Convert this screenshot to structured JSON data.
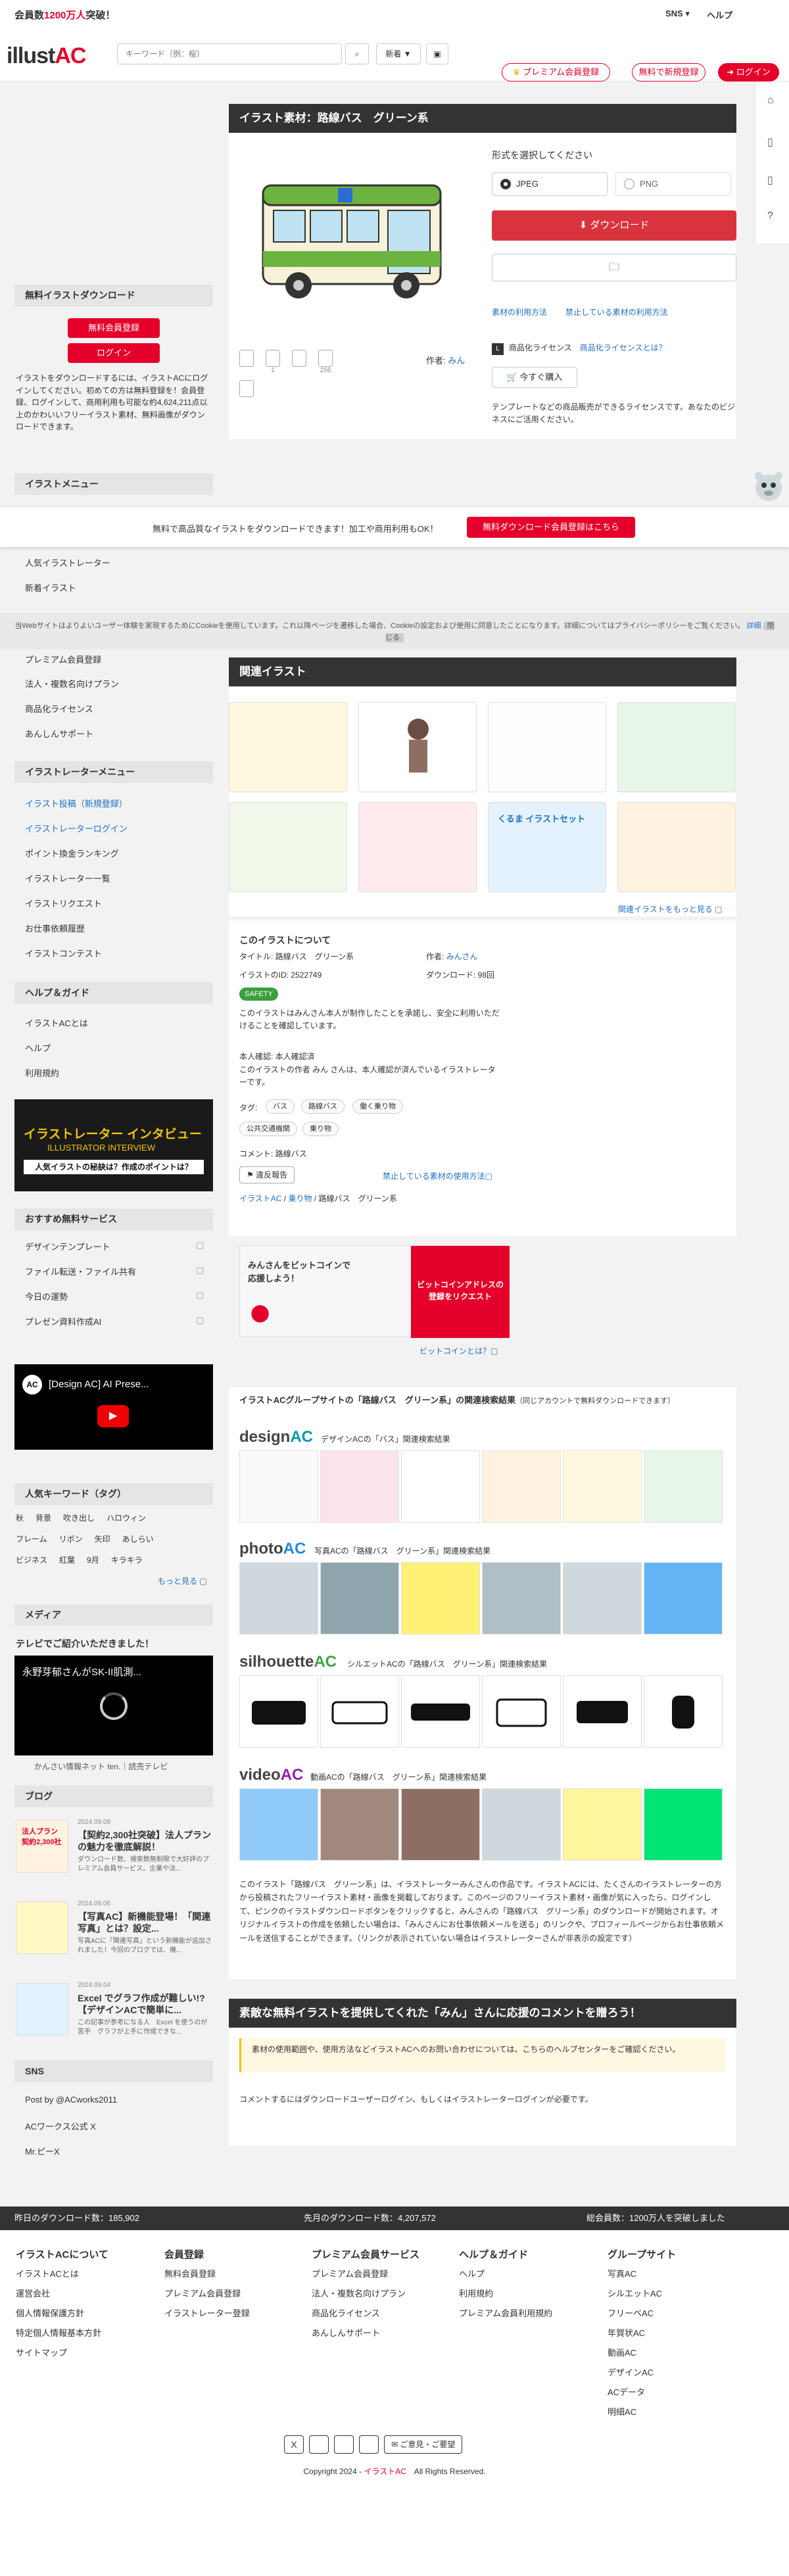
{
  "topbar": {
    "notice_prefix": "会員数",
    "notice_highlight": "1200万人",
    "notice_suffix": "突破！",
    "sns": "SNS ▾",
    "help": "ヘルプ"
  },
  "header": {
    "logo_text": "illust",
    "logo_ac": "AC",
    "search_placeholder": "キーワード（例：桜）",
    "sort_label": "新着 ▼",
    "premium_label": "プレミアム会員登録",
    "free_label": "無料で新規登録",
    "login_label": "ログイン"
  },
  "left": {
    "download_title": "無料イラストダウンロード",
    "free_register": "無料会員登録",
    "login": "ログイン",
    "download_text": "イラストをダウンロードするには、イラストACにログインしてください。初めての方は無料登録を！会員登録、ログインして、商用利用も可能な約4,624,211点以上のかわいいフリーイラスト素材、無料画像がダウンロードできます。",
    "menu_title": "イラストメニュー",
    "menu_items": [
      "人気イラストレーター",
      "新着イラスト",
      "プレミアム会員登録",
      "法人・複数名向けプラン",
      "商品化ライセンス",
      "あんしんサポート"
    ],
    "creator_title": "イラストレーターメニュー",
    "creator_items": [
      "イラスト投稿（新規登録）",
      "イラストレーターログイン",
      "ポイント換金ランキング",
      "イラストレーター一覧",
      "イラストリクエスト",
      "お仕事依頼履歴",
      "イラストコンテスト"
    ],
    "help_title": "ヘルプ＆ガイド",
    "help_items": [
      "イラストACとは",
      "ヘルプ",
      "利用規約"
    ],
    "interview": {
      "line1": "イラストレーター インタビュー",
      "line2": "ILLUSTRATOR INTERVIEW",
      "line3": "人気イラストの秘訣は？作成のポイントは？"
    },
    "services_title": "おすすめ無料サービス",
    "services": [
      "デザインテンプレート",
      "ファイル転送・ファイル共有",
      "今日の運勢",
      "プレゼン資料作成AI"
    ],
    "video1_title": "[Design AC] AI Prese...",
    "tags_title": "人気キーワード（タグ）",
    "tags_rows": [
      [
        "秋",
        "背景",
        "吹き出し",
        "ハロウィン"
      ],
      [
        "フレーム",
        "リボン",
        "矢印",
        "あしらい"
      ],
      [
        "ビジネス",
        "紅葉",
        "9月",
        "キラキラ"
      ]
    ],
    "tags_more": "もっと見る ▢",
    "media_title": "メディア",
    "media_text": "テレビでご紹介いただきました！",
    "video2_title": "永野芽郁さんがSK-II肌測...",
    "video2_caption": "かんさい情報ネット ten.｜読売テレビ",
    "blog_title": "ブログ",
    "blogs": [
      {
        "date": "2024.09.09",
        "title": "【契約2,300社突破】法人プランの魅力を徹底解説！",
        "excerpt": "ダウンロード数、検索数無制限で大好評のプレミアム会員サービス。企業や法..."
      },
      {
        "date": "2024.09.06",
        "title": "【写真AC】新機能登場！「関連写真」とは？設定...",
        "excerpt": "写真ACに「関連写真」という新機能が追加されました！今回のブログでは、機..."
      },
      {
        "date": "2024.09.04",
        "title": "Excel でグラフ作成が難しい!?【デザインACで簡単に...",
        "excerpt": "この記事が参考になる人　Excel を使うのが苦手　グラフが上手に作成できな..."
      }
    ],
    "blog_thumb_text": "法人プラン 契約2,300社",
    "sns_title": "SNS",
    "sns_items": [
      "Post by @ACworks2011",
      "ACワークス公式 X",
      "Mr.ピーX"
    ]
  },
  "detail": {
    "title": "イラスト素材：路線バス　グリーン系",
    "format_label": "形式を選択してください",
    "jpeg": "JPEG",
    "png": "PNG",
    "download_btn": "ダウンロード",
    "terms": "素材の利用方法",
    "prohibited": "禁止している素材の利用方法",
    "license_prefix": "商品化ライセンス",
    "license_link": "商品化ライセンスとは？",
    "buy_now": "今すぐ購入",
    "template_note": "テンプレートなどの商品販売ができるライセンスです。あなたのビジネスにご活用ください。",
    "author_label": "作者:",
    "author": "みん",
    "counts": [
      "",
      "1",
      "",
      "256"
    ]
  },
  "banner": {
    "text": "無料で高品質なイラストをダウンロードできます！加工や商用利用もOK！",
    "button": "無料ダウンロード会員登録はこちら"
  },
  "cookie": {
    "text": "当Webサイトはよりよいユーザー体験を実現するためにCookieを使用しています。これ以降ページを遷移した場合、Cookieの設定および使用に同意したことになります。詳細についてはプライバシーポリシーをご覧ください。",
    "details": "詳細",
    "close": "閉じる"
  },
  "related": {
    "title": "関連イラスト",
    "more": "関連イラストをもっと見る ▢",
    "thumb7_text": "くるま イラストセット"
  },
  "about": {
    "heading": "このイラストについて",
    "title_label": "タイトル: 路線バス　グリーン系",
    "author_label": "作者: ",
    "author": "みんさん",
    "id_label": "イラストのID: 2522749",
    "downloads_label": "ダウンロード: 98回",
    "safety": "SAFETY",
    "safety_text": "このイラストはみんさん本人が制作したことを承諾し、安全に利用いただけることを確認しています。",
    "verify_label": "本人確認: 本人確認済",
    "verify_text": "このイラストの作者 みん さんは、本人確認が済んでいるイラストレーターです。",
    "tags_label": "タグ:",
    "tags": [
      "バス",
      "路線バス",
      "働く乗り物",
      "公共交通機関",
      "乗り物"
    ],
    "comment_label": "コメント: 路線バス",
    "report": "違反報告",
    "prohibited": "禁止している素材の使用方法▢",
    "breadcrumb": [
      "イラストAC",
      "乗り物",
      "路線バス　グリーン系"
    ]
  },
  "bitcoin": {
    "text": "みんさんをビットコインで応援しよう！",
    "button_line1": "ビットコインアドレスの",
    "button_line2": "登録をリクエスト",
    "link": "ビットコインとは？▢"
  },
  "group": {
    "heading": "イラストACグループサイトの「路線バス　グリーン系」の関連検索結果",
    "heading_note": "（同じアカウントで無料ダウンロードできます）",
    "sites": [
      {
        "logo": "design",
        "ac": "AC",
        "label": "デザインACの「バス」関連検索結果"
      },
      {
        "logo": "photo",
        "ac": "AC",
        "label": "写真ACの「路線バス　グリーン系」関連検索結果"
      },
      {
        "logo": "silhouette",
        "ac": "AC",
        "label": "シルエットACの「路線バス　グリーン系」関連検索結果"
      },
      {
        "logo": "video",
        "ac": "AC",
        "label": "動画ACの「路線バス　グリーン系」関連検索結果"
      }
    ]
  },
  "description": "このイラスト「路線バス　グリーン系」は、イラストレーターみんさんの作品です。イラストACには、たくさんのイラストレーターの方から投稿されたフリーイラスト素材・画像を掲載しております。このページのフリーイラスト素材・画像が気に入ったら、ログインして、ピンクのイラストダウンロードボタンをクリックすると、みんさんの「路線バス　グリーン系」のダウンロードが開始されます。オリジナルイラストの作成を依頼したい場合は、「みんさんにお仕事依頼メールを送る」のリンクや、プロフィールページからお仕事依頼メールを送信することができます。（リンクが表示されていない場合はイラストレーターさんが非表示の設定です）",
  "comment_section": {
    "title": "素敵な無料イラストを提供してくれた「みん」さんに応援のコメントを贈ろう！",
    "notice": "素材の使用範囲や、使用方法などイラストACへのお問い合わせについては、こちらのヘルプセンターをご確認ください。",
    "login_note": "コメントするにはダウンロードユーザーログイン、もしくはイラストレーターログインが必要です。"
  },
  "footer": {
    "stat1": "昨日のダウンロード数：185,902",
    "stat2": "先月のダウンロード数：4,207,572",
    "stat3": "総会員数：1200万人を突破しました",
    "cols": [
      {
        "title": "イラストACについて",
        "items": [
          "イラストACとは",
          "運営会社",
          "個人情報保護方針",
          "特定個人情報基本方針",
          "サイトマップ"
        ]
      },
      {
        "title": "会員登録",
        "items": [
          "無料会員登録",
          "プレミアム会員登録",
          "イラストレーター登録"
        ]
      },
      {
        "title": "プレミアム会員サービス",
        "items": [
          "プレミアム会員登録",
          "法人・複数名向けプラン",
          "商品化ライセンス",
          "あんしんサポート"
        ]
      },
      {
        "title": "ヘルプ＆ガイド",
        "items": [
          "ヘルプ",
          "利用規約",
          "プレミアム会員利用規約"
        ]
      },
      {
        "title": "グループサイト",
        "items": [
          "写真AC",
          "シルエットAC",
          "フリーベAC",
          "年賀状AC",
          "動画AC",
          "デザインAC",
          "ACデータ",
          "明細AC"
        ]
      }
    ],
    "feedback": "ご意見・ご要望",
    "copyright_prefix": "Copyright 2024 - ",
    "copyright_brand": "イラストAC",
    "copyright_suffix": "　All Rights Reserved."
  }
}
